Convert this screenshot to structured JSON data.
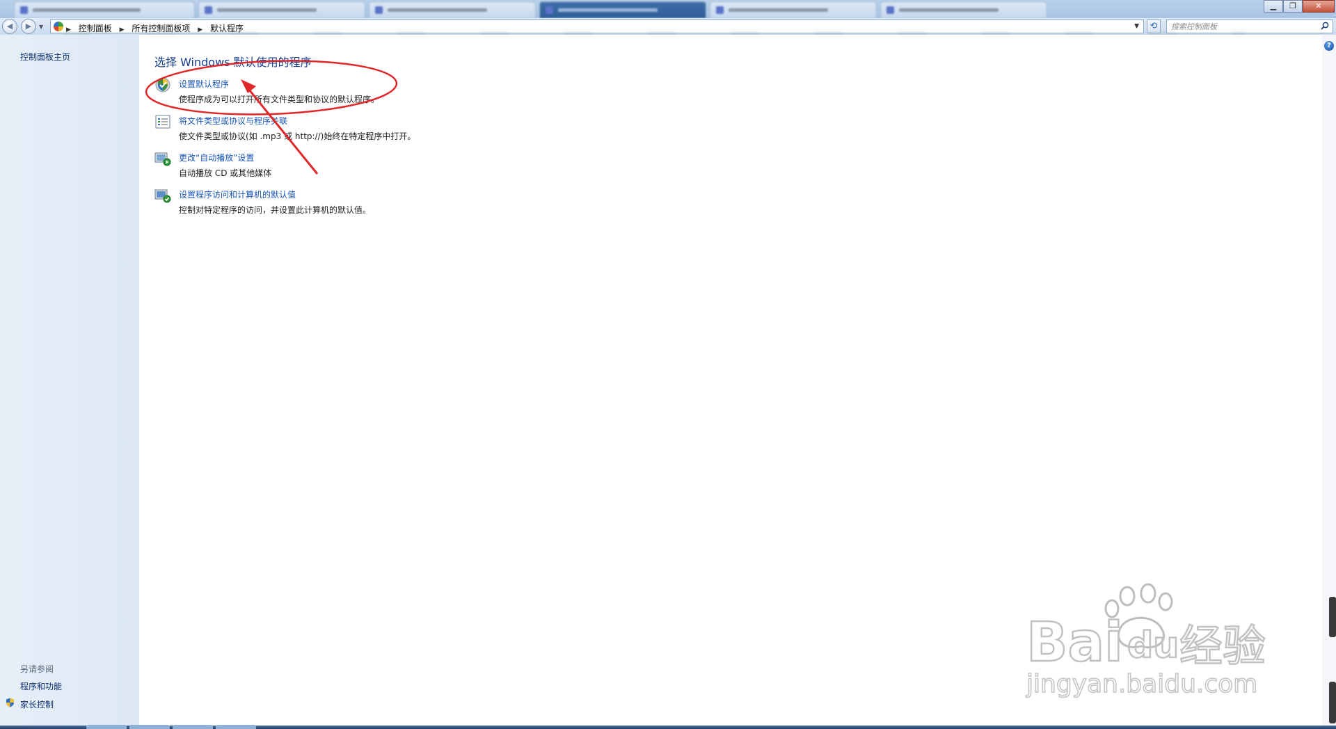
{
  "window": {
    "minimize_label": "▁",
    "maximize_label": "❐",
    "close_label": "✕"
  },
  "address_bar": {
    "crumbs": [
      "控制面板",
      "所有控制面板项",
      "默认程序"
    ],
    "search_placeholder": "搜索控制面板"
  },
  "sidebar": {
    "home_link": "控制面板主页",
    "see_also_title": "另请参阅",
    "see_also_links": [
      "程序和功能",
      "家长控制"
    ]
  },
  "main": {
    "title": "选择 Windows 默认使用的程序",
    "items": [
      {
        "link": "设置默认程序",
        "desc": "使程序成为可以打开所有文件类型和协议的默认程序。",
        "icon": "default-programs-icon"
      },
      {
        "link": "将文件类型或协议与程序关联",
        "desc": "使文件类型或协议(如 .mp3 或 http://)始终在特定程序中打开。",
        "icon": "file-association-icon"
      },
      {
        "link": "更改“自动播放”设置",
        "desc": "自动播放 CD 或其他媒体",
        "icon": "autoplay-icon"
      },
      {
        "link": "设置程序访问和计算机的默认值",
        "desc": "控制对特定程序的访问，并设置此计算机的默认值。",
        "icon": "program-access-icon"
      }
    ]
  },
  "help_label": "?",
  "watermark": {
    "brand": "Bai",
    "brand_du": "du",
    "brand_cn": "经验",
    "url": "jingyan.baidu.com"
  },
  "colors": {
    "link": "#1a56b8",
    "title": "#153b8c",
    "annotation": "#e0282a",
    "sidebar_bg": "#e2ebf6"
  }
}
